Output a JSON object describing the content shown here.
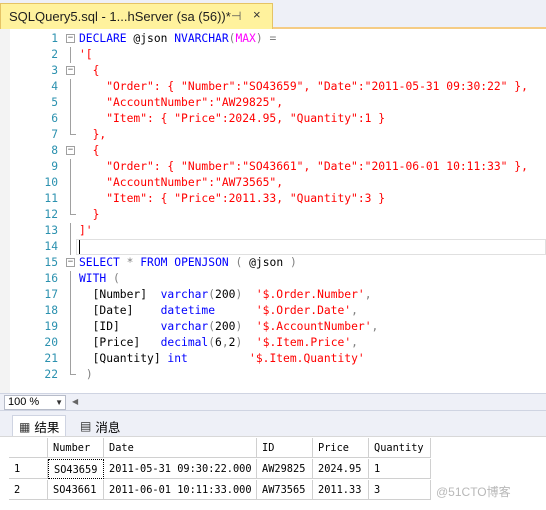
{
  "tab": {
    "title": "SQLQuery5.sql - 1...hServer (sa (56))*",
    "pin": "⊣",
    "close": "×"
  },
  "editor": {
    "lines": [
      {
        "n": "1",
        "html": "<span class='kw'>DECLARE</span> @json <span class='kw'>NVARCHAR</span><span class='gy'>(</span><span class='fn'>MAX</span><span class='gy'>)</span> <span class='gy'>=</span>"
      },
      {
        "n": "2",
        "html": "<span class='st'>'[</span>"
      },
      {
        "n": "3",
        "html": "<span class='st'>  {</span>"
      },
      {
        "n": "4",
        "html": "<span class='st'>    \"Order\": { \"Number\":\"SO43659\", \"Date\":\"2011-05-31 09:30:22\" },</span>"
      },
      {
        "n": "5",
        "html": "<span class='st'>    \"AccountNumber\":\"AW29825\",</span>"
      },
      {
        "n": "6",
        "html": "<span class='st'>    \"Item\": { \"Price\":2024.95, \"Quantity\":1 }</span>"
      },
      {
        "n": "7",
        "html": "<span class='st'>  },</span>"
      },
      {
        "n": "8",
        "html": "<span class='st'>  {</span>"
      },
      {
        "n": "9",
        "html": "<span class='st'>    \"Order\": { \"Number\":\"SO43661\", \"Date\":\"2011-06-01 10:11:33\" },</span>"
      },
      {
        "n": "10",
        "html": "<span class='st'>    \"AccountNumber\":\"AW73565\",</span>"
      },
      {
        "n": "11",
        "html": "<span class='st'>    \"Item\": { \"Price\":2011.33, \"Quantity\":3 }</span>"
      },
      {
        "n": "12",
        "html": "<span class='st'>  }</span>"
      },
      {
        "n": "13",
        "html": "<span class='st'>]'</span>"
      },
      {
        "n": "14",
        "html": ""
      },
      {
        "n": "15",
        "html": "<span class='kw'>SELECT</span> <span class='gy'>*</span> <span class='kw'>FROM</span> <span class='kw'>OPENJSON</span> <span class='gy'>(</span> @json <span class='gy'>)</span>"
      },
      {
        "n": "16",
        "html": "<span class='kw'>WITH</span> <span class='gy'>(</span>"
      },
      {
        "n": "17",
        "html": "  [Number]  <span class='kw'>varchar</span><span class='gy'>(</span>200<span class='gy'>)</span>  <span class='st'>'$.Order.Number'</span><span class='gy'>,</span>"
      },
      {
        "n": "18",
        "html": "  [Date]    <span class='kw'>datetime</span>      <span class='st'>'$.Order.Date'</span><span class='gy'>,</span>"
      },
      {
        "n": "19",
        "html": "  [ID]      <span class='kw'>varchar</span><span class='gy'>(</span>200<span class='gy'>)</span>  <span class='st'>'$.AccountNumber'</span><span class='gy'>,</span>"
      },
      {
        "n": "20",
        "html": "  [Price]   <span class='kw'>decimal</span><span class='gy'>(</span>6<span class='gy'>,</span>2<span class='gy'>)</span>  <span class='st'>'$.Item.Price'</span><span class='gy'>,</span>"
      },
      {
        "n": "21",
        "html": "  [Quantity] <span class='kw'>int</span>         <span class='st'>'$.Item.Quantity'</span>"
      },
      {
        "n": "22",
        "html": " <span class='gy'>)</span>"
      }
    ]
  },
  "zoom": {
    "value": "100 %"
  },
  "results_tabs": [
    {
      "label": "结果",
      "icon": "▦"
    },
    {
      "label": "消息",
      "icon": "▤"
    }
  ],
  "grid": {
    "columns": [
      "Number",
      "Date",
      "ID",
      "Price",
      "Quantity"
    ],
    "rows": [
      {
        "row": "1",
        "cells": [
          "SO43659",
          "2011-05-31 09:30:22.000",
          "AW29825",
          "2024.95",
          "1"
        ]
      },
      {
        "row": "2",
        "cells": [
          "SO43661",
          "2011-06-01 10:11:33.000",
          "AW73565",
          "2011.33",
          "3"
        ]
      }
    ]
  },
  "watermark": "@51CTO博客"
}
